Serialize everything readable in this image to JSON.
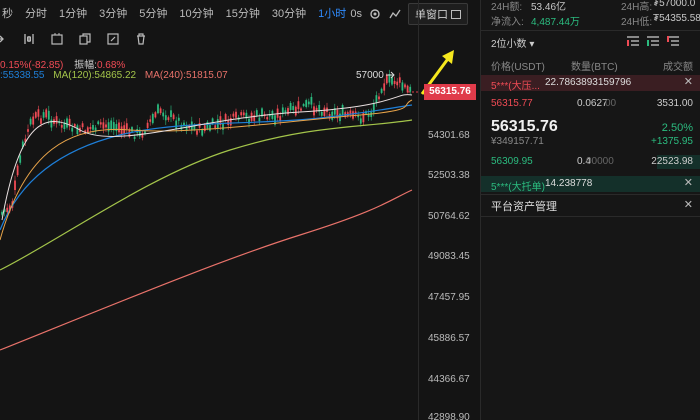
{
  "toolbar": {
    "timeframes": [
      "秒",
      "分时",
      "1分钟",
      "3分钟",
      "5分钟",
      "10分钟",
      "15分钟",
      "30分钟",
      "1小时"
    ],
    "active_index": 8,
    "zero_s": "0s",
    "chart_type": "单窗口"
  },
  "tools": [
    "cursor-icon",
    "compare-icon",
    "stack-icon",
    "square-split-icon",
    "trash-icon"
  ],
  "indicators": {
    "line1_prefix": "0.15%(-82.85)",
    "line1_amp_label": "振幅:",
    "line1_amp_value": "0.68%",
    "ma_short": ":55338.55",
    "ma120": "MA(120):54865.22",
    "ma240": "MA(240):51815.07"
  },
  "price_axis": {
    "ticks": [
      "54301.68",
      "52503.38",
      "50764.62",
      "49083.45",
      "47457.95",
      "45886.57",
      "44366.67",
      "42898.90"
    ],
    "last_price": "56315.76",
    "high_marker": "57000"
  },
  "colors": {
    "up": "#2bbb7f",
    "down": "#f04b55",
    "accent": "#2f8cff",
    "ma_short": "#1e7fd8",
    "ma120": "#a3c44a",
    "ma240": "#e8726a",
    "arrow": "#f6e81e"
  },
  "summary": {
    "vol24_label": "24H额:",
    "vol24_value": "53.46亿",
    "high24_label": "24H高:",
    "high24_value": "₮57000.0",
    "inflow_label": "净流入:",
    "inflow_value": "4,487.44万",
    "low24_label": "24H低:",
    "low24_value": "₮54355.58"
  },
  "orderbook": {
    "precision": "2位小数",
    "col_price": "价格(USDT)",
    "col_qty": "数量(BTC)",
    "col_total": "成交额",
    "ask_tag": "5***(大压...",
    "ask_tag_value": "22.7863893159796",
    "ask_price": "56315.77",
    "ask_qty": "0.0627",
    "ask_qty_suffix": "00",
    "ask_total": "3531.00",
    "mid_price": "56315.76",
    "mid_pct": "2.50%",
    "mid_sub": "¥349157.71",
    "mid_change": "+1375.95",
    "bid_price": "56309.95",
    "bid_qty": "0.4",
    "bid_qty_suffix": "00000",
    "bid_total": "22523.98",
    "bid_tag": "5***(大托单)",
    "bid_tag_value": "14.238778",
    "assets_title": "平台资产管理"
  }
}
